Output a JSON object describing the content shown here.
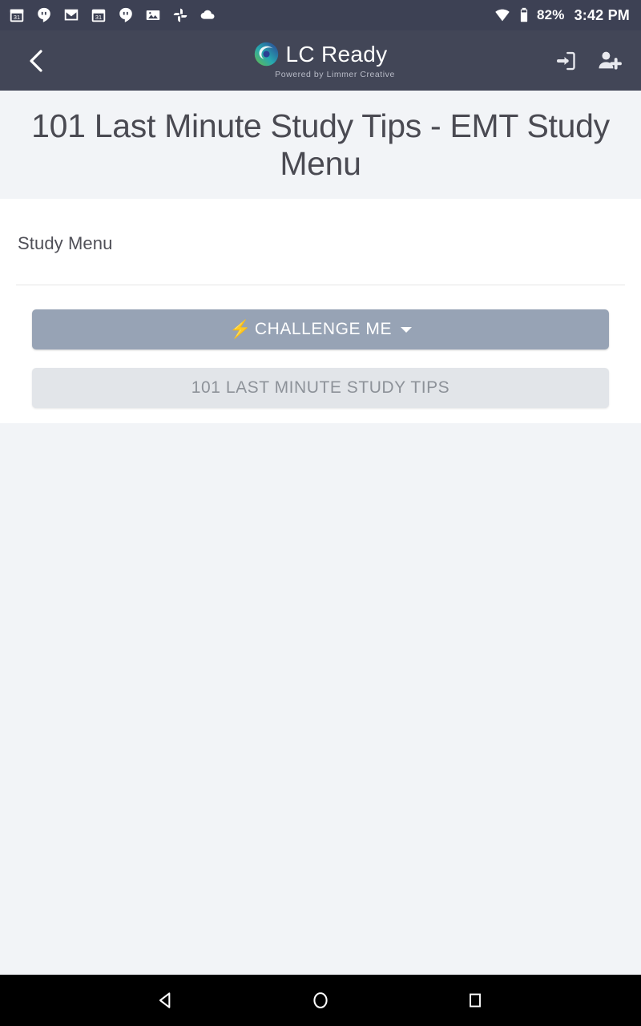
{
  "status_bar": {
    "notification_icons": [
      "calendar-icon",
      "hangouts-icon",
      "gmail-icon",
      "calendar-icon",
      "hangouts-icon",
      "photos-image-icon",
      "google-photos-pinwheel-icon",
      "cloud-icon"
    ],
    "wifi_icon": "wifi-icon",
    "battery_icon": "battery-icon",
    "battery_percent": "82%",
    "time": "3:42 PM",
    "background_color": "#3d4154"
  },
  "navbar": {
    "back_icon": "chevron-left-icon",
    "brand_name": "LC Ready",
    "brand_tagline": "Powered by Limmer Creative",
    "logo_icon": "lc-ready-logo-icon",
    "logo_colors": {
      "green": "#5cb85c",
      "blue": "#2b3f93",
      "teal": "#3cb0c9"
    },
    "actions": [
      {
        "name": "sign-in-icon",
        "label": "Sign In"
      },
      {
        "name": "add-user-icon",
        "label": "Register"
      }
    ],
    "background_color": "#424657"
  },
  "title_band": {
    "title": "101 Last Minute Study Tips - EMT Study Menu",
    "background_color": "#f2f4f7",
    "text_color": "#4a4a52"
  },
  "content": {
    "section_heading": "Study Menu",
    "buttons": [
      {
        "label": "CHALLENGE ME",
        "icon": "lightning-bolt-icon",
        "has_dropdown": true,
        "style": "primary",
        "background_color": "#97a3b5",
        "text_color": "#ffffff"
      },
      {
        "label": "101 LAST MINUTE STUDY TIPS",
        "icon": null,
        "has_dropdown": false,
        "style": "secondary",
        "background_color": "#e2e5e9",
        "text_color": "#8d9299"
      }
    ]
  },
  "system_nav": {
    "back_icon": "triangle-back-icon",
    "home_icon": "circle-home-icon",
    "recents_icon": "square-recents-icon",
    "background_color": "#000000"
  }
}
